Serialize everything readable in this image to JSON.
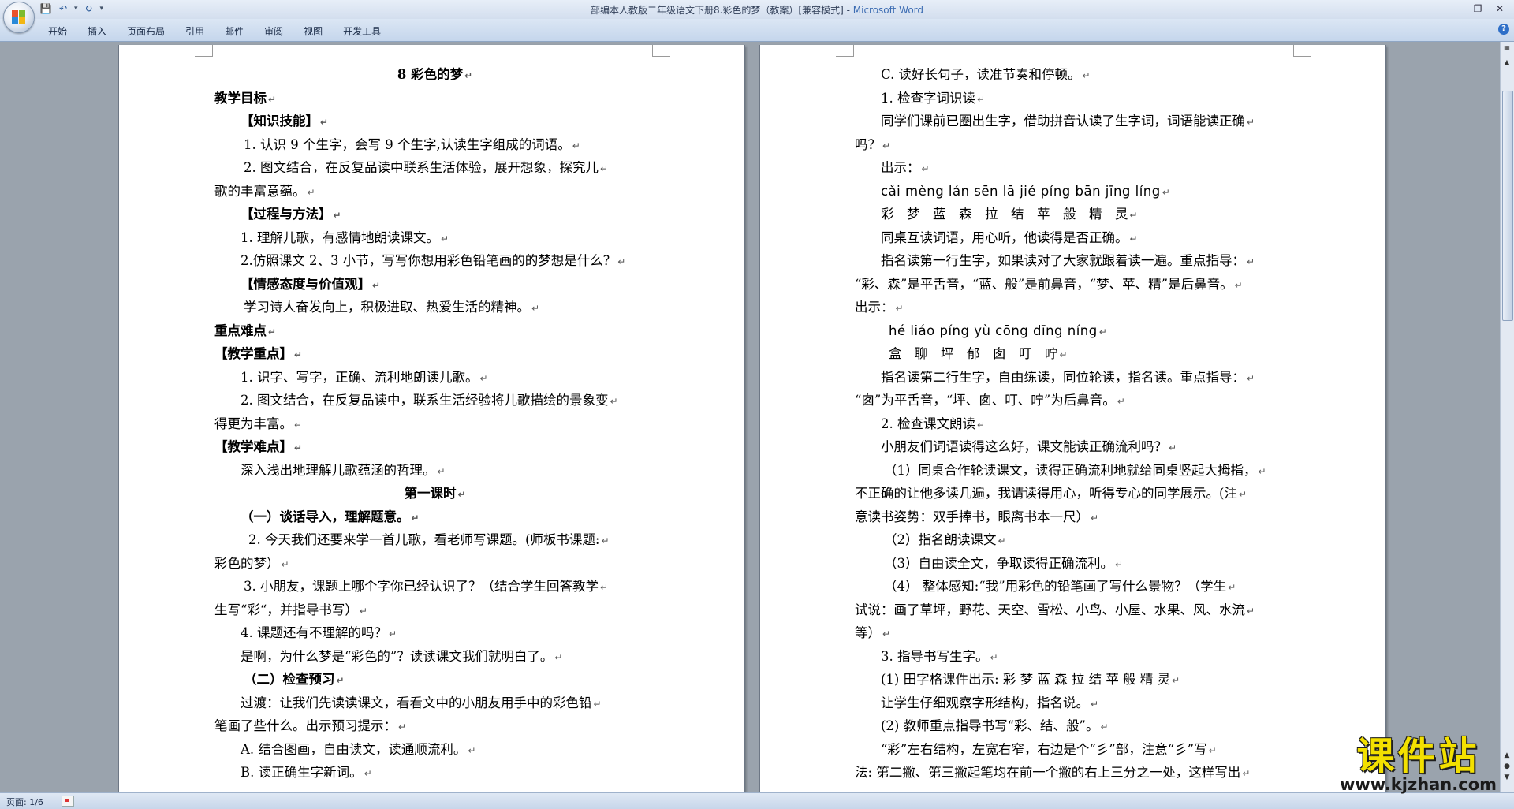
{
  "window": {
    "title_prefix": "部编本人教版二年级语文下册8.彩色的梦（教案）[兼容模式] - ",
    "title_brand": "Microsoft Word"
  },
  "ribbon": {
    "tabs": [
      "开始",
      "插入",
      "页面布局",
      "引用",
      "邮件",
      "审阅",
      "视图",
      "开发工具"
    ]
  },
  "status": {
    "page": "页面: 1/6"
  },
  "watermark": {
    "main": "课件站",
    "url": "www.kjzhan.com"
  },
  "pages": {
    "left": {
      "lines": [
        {
          "t": "8 彩色的梦",
          "s": "bold center"
        },
        {
          "t": "教学目标",
          "s": "bold"
        },
        {
          "t": "【知识技能】",
          "s": "bold ind1"
        },
        {
          "t": "1. 认识 9 个生字，会写 9 个生字,认读生字组成的词语。",
          "s": "ind2"
        },
        {
          "t": "2. 图文结合，在反复品读中联系生活体验，展开想象，探究儿",
          "s": "ind2"
        },
        {
          "t": "歌的丰富意蕴。",
          "s": ""
        },
        {
          "t": "【过程与方法】",
          "s": "bold ind1"
        },
        {
          "t": "1. 理解儿歌，有感情地朗读课文。",
          "s": "ind1"
        },
        {
          "t": "2.仿照课文 2、3 小节，写写你想用彩色铅笔画的的梦想是什么？",
          "s": "ind1"
        },
        {
          "t": "【情感态度与价值观】",
          "s": "bold ind1"
        },
        {
          "t": "学习诗人奋发向上，积极进取、热爱生活的精神。",
          "s": "ind2"
        },
        {
          "t": "重点难点",
          "s": "bold"
        },
        {
          "t": "【教学重点】",
          "s": "bold"
        },
        {
          "t": "1. 识字、写字，正确、流利地朗读儿歌。",
          "s": "ind1"
        },
        {
          "t": "2. 图文结合，在反复品读中，联系生活经验将儿歌描绘的景象变",
          "s": "ind1"
        },
        {
          "t": "得更为丰富。",
          "s": ""
        },
        {
          "t": "【教学难点】",
          "s": "bold"
        },
        {
          "t": "深入浅出地理解儿歌蕴涵的哲理。",
          "s": "ind1"
        },
        {
          "t": "第一课时",
          "s": "bold center"
        },
        {
          "t": "（一）谈话导入，理解题意。",
          "s": "bold ind1"
        },
        {
          "t": "2. 今天我们还要来学一首儿歌，看老师写课题。(师板书课题:",
          "s": "ind3"
        },
        {
          "t": "彩色的梦）",
          "s": ""
        },
        {
          "t": "3. 小朋友，课题上哪个字你已经认识了？（结合学生回答教学",
          "s": "ind2"
        },
        {
          "t": "生写“彩“，并指导书写）",
          "s": ""
        },
        {
          "t": "4. 课题还有不理解的吗？",
          "s": "ind1"
        },
        {
          "t": "是啊，为什么梦是“彩色的”？读读课文我们就明白了。",
          "s": "ind1"
        },
        {
          "t": "（二）检查预习",
          "s": "bold ind2"
        },
        {
          "t": "过渡：让我们先读读课文，看看文中的小朋友用手中的彩色铅",
          "s": "ind1"
        },
        {
          "t": "笔画了些什么。出示预习提示：",
          "s": ""
        },
        {
          "t": "A. 结合图画，自由读文，读通顺流利。",
          "s": "ind1"
        },
        {
          "t": "B. 读正确生字新词。",
          "s": "ind1"
        }
      ]
    },
    "right": {
      "lines": [
        {
          "t": "C. 读好长句子，读准节奏和停顿。",
          "s": "ind1"
        },
        {
          "t": "1. 检查字词识读",
          "s": "ind1"
        },
        {
          "t": "同学们课前已圈出生字，借助拼音认读了生字词，词语能读正确",
          "s": "ind1"
        },
        {
          "t": "吗？",
          "s": ""
        },
        {
          "t": "出示：",
          "s": "ind1"
        },
        {
          "t": "cǎi mèng lán sēn lā jié píng bān jīng líng",
          "s": "pinyin ind1"
        },
        {
          "t": "彩　梦　蓝　森　拉　结　苹　般　精　灵",
          "s": "ind1"
        },
        {
          "t": "同桌互读词语，用心听，他读得是否正确。",
          "s": "ind1"
        },
        {
          "t": "指名读第一行生字，如果读对了大家就跟着读一遍。重点指导：",
          "s": "ind1"
        },
        {
          "t": "“彩、森”是平舌音，“蓝、般”是前鼻音，“梦、苹、精”是后鼻音。",
          "s": ""
        },
        {
          "t": "出示：",
          "s": ""
        },
        {
          "t": "hé liáo píng yù cōng dīng níng",
          "s": "pinyin ind3"
        },
        {
          "t": "盒　聊　坪　郁　囱　叮　咛",
          "s": "ind3"
        },
        {
          "t": "指名读第二行生字，自由练读，同位轮读，指名读。重点指导：",
          "s": "ind1"
        },
        {
          "t": "“囱”为平舌音，“坪、囱、叮、咛”为后鼻音。",
          "s": ""
        },
        {
          "t": "2. 检查课文朗读",
          "s": "ind1"
        },
        {
          "t": "小朋友们词语读得这么好，课文能读正确流利吗？",
          "s": "ind1"
        },
        {
          "t": "（1）同桌合作轮读课文，读得正确流利地就给同桌竖起大拇指，",
          "s": "ind2"
        },
        {
          "t": "不正确的让他多读几遍，我请读得用心，听得专心的同学展示。(注",
          "s": ""
        },
        {
          "t": "意读书姿势：双手捧书，眼离书本一尺）",
          "s": ""
        },
        {
          "t": "（2）指名朗读课文",
          "s": "ind2"
        },
        {
          "t": "（3）自由读全文，争取读得正确流利。",
          "s": "ind2"
        },
        {
          "t": "（4） 整体感知:“我”用彩色的铅笔画了写什么景物？（学生",
          "s": "ind2"
        },
        {
          "t": "试说：画了草坪，野花、天空、雪松、小鸟、小屋、水果、风、水流",
          "s": ""
        },
        {
          "t": "等）",
          "s": ""
        },
        {
          "t": "3. 指导书写生字。",
          "s": "ind1"
        },
        {
          "t": "(1) 田字格课件出示: 彩 梦 蓝 森 拉 结 苹 般 精 灵",
          "s": "ind1"
        },
        {
          "t": "让学生仔细观察字形结构，指名说。",
          "s": "ind1"
        },
        {
          "t": "(2) 教师重点指导书写“彩、结、般”。",
          "s": "ind1"
        },
        {
          "t": "“彩”左右结构，左宽右窄，右边是个“彡”部，注意“彡”写",
          "s": "ind1"
        },
        {
          "t": "法: 第二撇、第三撇起笔均在前一个撇的右上三分之一处，这样写出",
          "s": ""
        }
      ]
    }
  }
}
